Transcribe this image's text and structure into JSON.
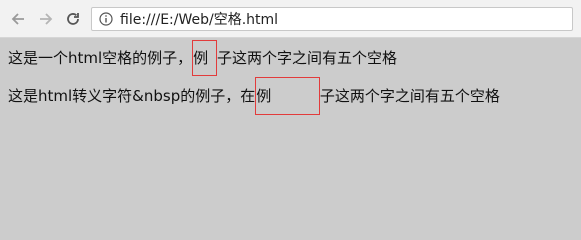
{
  "browser": {
    "address": "file:///E:/Web/空格.html",
    "icons": {
      "back": "arrow-left",
      "forward": "arrow-right",
      "reload": "reload",
      "page_info": "info-circle"
    }
  },
  "content": {
    "line1": {
      "before": "这是一个html空格的例子，",
      "highlight": "例 ",
      "after": "子这两个字之间有五个空格"
    },
    "line2": {
      "before": "这是html转义字符&nbsp的例子，在",
      "highlight": "例          ",
      "after": "子这两个字之间有五个空格"
    }
  },
  "colors": {
    "page_background": "#cccccc",
    "highlight_border": "#e23b3b",
    "toolbar": "#f2f2f2"
  }
}
